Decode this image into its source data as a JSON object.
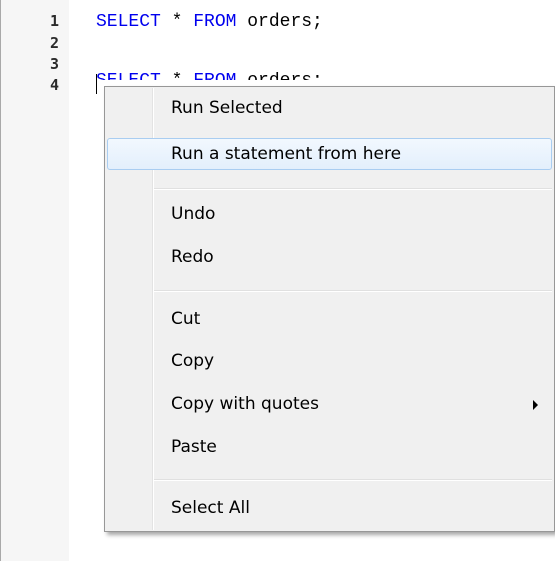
{
  "editor": {
    "line_numbers": [
      "1",
      "2",
      "3",
      "4"
    ],
    "line1": {
      "select_kw": "SELECT",
      "star": " * ",
      "from_kw": "FROM",
      "table": " orders;"
    },
    "line3_partial": {
      "select_kw": "SELECT",
      "star": " * ",
      "from_kw": "FROM",
      "table": " orders;"
    }
  },
  "context_menu": {
    "items": [
      {
        "label": "Run Selected"
      },
      {
        "label": "Run a statement from here"
      },
      {
        "label": "Undo"
      },
      {
        "label": "Redo"
      },
      {
        "label": "Cut"
      },
      {
        "label": "Copy"
      },
      {
        "label": "Copy with quotes"
      },
      {
        "label": "Paste"
      },
      {
        "label": "Select All"
      }
    ],
    "highlighted_item": "Run a statement from here"
  },
  "colors": {
    "keyword": "#0000ee",
    "menu_background": "#f0f0f0",
    "highlight_border": "#a9cdf1"
  }
}
